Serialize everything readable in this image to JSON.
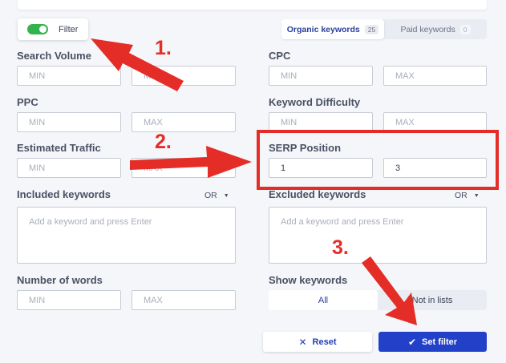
{
  "filter": {
    "label": "Filter",
    "enabled": true,
    "toggle_color": "#34b24c"
  },
  "keyword_tabs": [
    {
      "label": "Organic keywords",
      "count": "25",
      "active": true
    },
    {
      "label": "Paid keywords",
      "count": "0",
      "active": false
    }
  ],
  "fields": {
    "search_volume": {
      "label": "Search Volume",
      "min_placeholder": "MIN",
      "max_placeholder": "MAX"
    },
    "cpc": {
      "label": "CPC",
      "min_placeholder": "MIN",
      "max_placeholder": "MAX"
    },
    "ppc": {
      "label": "PPC",
      "min_placeholder": "MIN",
      "max_placeholder": "MAX"
    },
    "keyword_difficulty": {
      "label": "Keyword Difficulty",
      "min_placeholder": "MIN",
      "max_placeholder": "MAX"
    },
    "estimated_traffic": {
      "label": "Estimated Traffic",
      "min_placeholder": "MIN",
      "max_placeholder": "MAX"
    },
    "serp_position": {
      "label": "SERP Position",
      "min_value": "1",
      "max_value": "3"
    },
    "included_keywords": {
      "label": "Included keywords",
      "operator": "OR",
      "placeholder": "Add a keyword and press Enter"
    },
    "excluded_keywords": {
      "label": "Excluded keywords",
      "operator": "OR",
      "placeholder": "Add a keyword and press Enter"
    },
    "number_of_words": {
      "label": "Number of words",
      "min_placeholder": "MIN",
      "max_placeholder": "MAX"
    },
    "show_keywords": {
      "label": "Show keywords",
      "options": [
        "All",
        "Not in lists"
      ],
      "selected": "All"
    }
  },
  "actions": {
    "reset_label": "Reset",
    "set_filter_label": "Set filter"
  },
  "annotations": {
    "step1": "1.",
    "step2": "2.",
    "step3": "3.",
    "color": "#e52d27"
  },
  "colors": {
    "primary": "#2340c8",
    "accent_text": "#2a3f9d",
    "background": "#f4f6fa"
  }
}
